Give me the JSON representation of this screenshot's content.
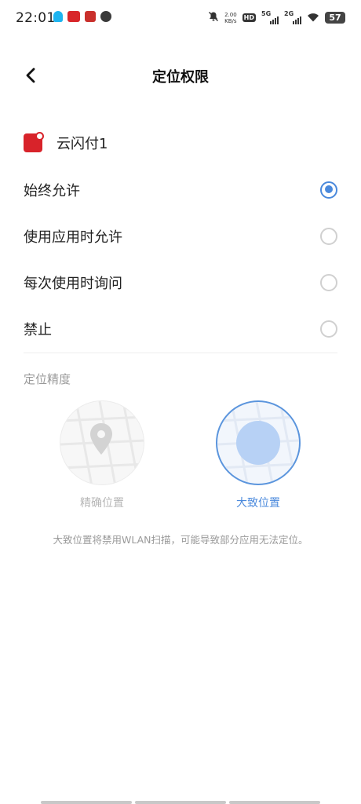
{
  "status_bar": {
    "time": "22:01",
    "speed_value": "2.00",
    "speed_unit": "KB/s",
    "hd": "HD",
    "net1": "5G",
    "net2": "2G",
    "battery": "57",
    "left_icons": [
      "qq-icon",
      "app-red-icon",
      "app-red-icon-2",
      "gray-app-icon"
    ],
    "right_icons": [
      "mute-icon",
      "wifi-icon"
    ]
  },
  "header": {
    "title": "定位权限",
    "back_icon": "chevron-left-icon"
  },
  "app": {
    "name": "云闪付1",
    "icon": "unionpay-app-icon"
  },
  "options": [
    {
      "label": "始终允许",
      "selected": true
    },
    {
      "label": "使用应用时允许",
      "selected": false
    },
    {
      "label": "每次使用时询问",
      "selected": false
    },
    {
      "label": "禁止",
      "selected": false
    }
  ],
  "precision": {
    "section_title": "定位精度",
    "precise_label": "精确位置",
    "approx_label": "大致位置",
    "selected": "approx",
    "note": "大致位置将禁用WLAN扫描，可能导致部分应用无法定位。"
  },
  "colors": {
    "accent": "#4a89dc",
    "radio_unselected": "#d0d0d0",
    "muted_text": "#9a9a9a"
  }
}
